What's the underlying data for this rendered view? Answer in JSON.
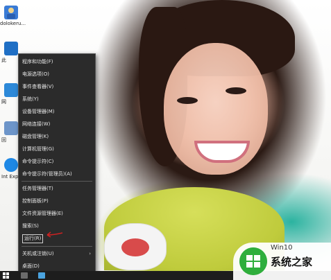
{
  "desktop": {
    "icons": [
      {
        "name": "user-folder",
        "label": "dolokeru..."
      },
      {
        "name": "this-pc",
        "label": "此"
      },
      {
        "name": "network",
        "label": "网"
      },
      {
        "name": "recycle-bin",
        "label": "回"
      },
      {
        "name": "ie",
        "label": "Int Exp"
      }
    ]
  },
  "context_menu": {
    "items": [
      {
        "label": "程序和功能(F)"
      },
      {
        "label": "电源选项(O)"
      },
      {
        "label": "事件查看器(V)"
      },
      {
        "label": "系统(Y)"
      },
      {
        "label": "设备管理器(M)"
      },
      {
        "label": "网络连接(W)"
      },
      {
        "label": "磁盘管理(K)"
      },
      {
        "label": "计算机管理(G)"
      },
      {
        "label": "命令提示符(C)"
      },
      {
        "label": "命令提示符(管理员)(A)"
      },
      {
        "label": "任务管理器(T)"
      },
      {
        "label": "控制面板(P)"
      },
      {
        "label": "文件资源管理器(E)"
      },
      {
        "label": "搜索(S)"
      },
      {
        "label": "运行(R)"
      },
      {
        "label": "关机或注销(U)",
        "submenu_arrow": "›"
      },
      {
        "label": "桌面(D)"
      }
    ]
  },
  "watermark": {
    "text": "系统之家",
    "logo_text": "Win10"
  },
  "colors": {
    "menu_bg": "#2b2b2b",
    "menu_text": "#e8e8e8",
    "taskbar": "#1d1d1d",
    "arrow": "#cc2222",
    "logo_green": "#2fae3c"
  }
}
